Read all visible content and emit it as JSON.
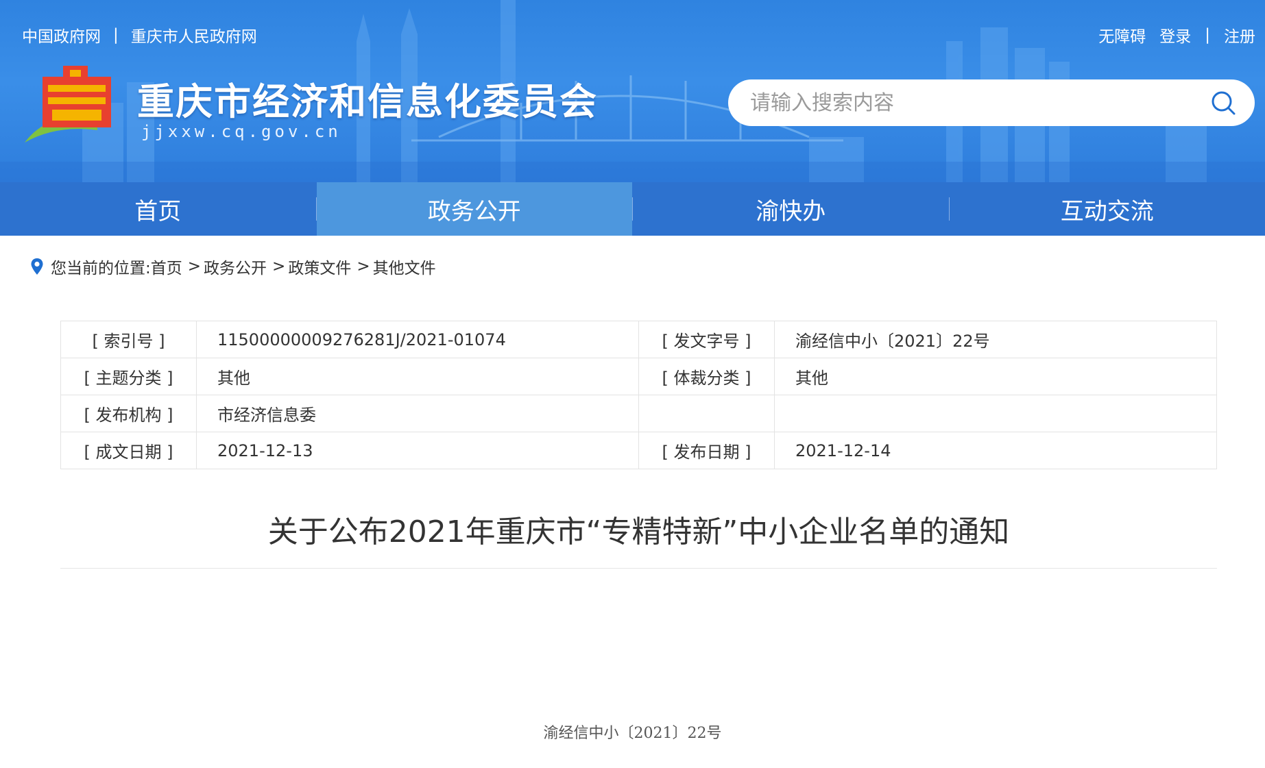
{
  "header": {
    "top_links_left": [
      "中国政府网",
      "重庆市人民政府网"
    ],
    "top_links_left_separator": "|",
    "top_links_right": {
      "accessibility": "无障碍",
      "login": "登录",
      "separator": "|",
      "register": "注册"
    },
    "site_title": "重庆市经济和信息化委员会",
    "site_domain": "jjxxw.cq.gov.cn",
    "search": {
      "placeholder": "请输入搜索内容",
      "value": ""
    }
  },
  "nav": {
    "items": [
      {
        "label": "首页"
      },
      {
        "label": "政务公开"
      },
      {
        "label": "渝快办"
      },
      {
        "label": "互动交流"
      }
    ],
    "active_index": 1
  },
  "breadcrumb": {
    "prefix": "您当前的位置:",
    "items": [
      "首页",
      "政务公开",
      "政策文件",
      "其他文件"
    ],
    "separator": ">"
  },
  "meta": {
    "rows": [
      {
        "label1": "[ 索引号 ]",
        "value1": "11500000009276281J/2021-01074",
        "label2": "[ 发文字号 ]",
        "value2": "渝经信中小〔2021〕22号"
      },
      {
        "label1": "[ 主题分类 ]",
        "value1": "其他",
        "label2": "[ 体裁分类 ]",
        "value2": "其他"
      },
      {
        "label1": "[ 发布机构 ]",
        "value1": "市经济信息委",
        "label2": "",
        "value2": ""
      },
      {
        "label1": "[ 成文日期 ]",
        "value1": "2021-12-13",
        "label2": "[ 发布日期 ]",
        "value2": "2021-12-14"
      }
    ]
  },
  "article": {
    "title": "关于公布2021年重庆市“专精特新”中小企业名单的通知",
    "doc_number": "渝经信中小〔2021〕22号"
  },
  "colors": {
    "banner_blue": "#3a8ee8",
    "nav_blue": "#2d72cf",
    "nav_active": "#4d97de",
    "text": "#333333"
  },
  "icons": {
    "search": "search-icon",
    "location": "location-pin-icon",
    "logo": "site-logo-icon"
  }
}
